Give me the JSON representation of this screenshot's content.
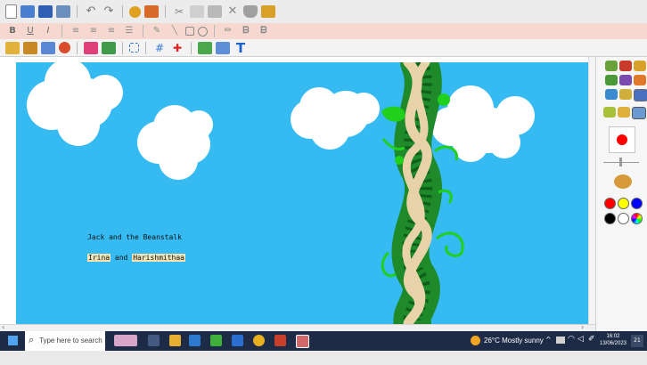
{
  "toolbars": {
    "row1": [
      "new-icon",
      "open-icon",
      "save-icon",
      "print-icon",
      "undo-icon",
      "redo-icon",
      "refresh-icon",
      "paint-icon",
      "cut-icon",
      "copy-icon",
      "paste-icon",
      "delete-icon",
      "shield-icon",
      "image-icon"
    ],
    "row2": [
      "bold-icon",
      "underline-icon",
      "italic-icon",
      "align-left-icon",
      "align-center-icon",
      "align-right-icon",
      "justify-icon",
      "pen-icon",
      "line-icon",
      "rectangle-icon",
      "ellipse-icon",
      "pencil-icon",
      "shape-b-icon",
      "shape-c-icon"
    ],
    "row3": [
      "brush-icon",
      "fill-icon",
      "eraser-icon",
      "stamp-icon",
      "flower-icon",
      "spray-icon",
      "select-icon",
      "grid-icon",
      "color-pick-icon",
      "paint-bucket-icon",
      "resize-icon",
      "text-tool-icon"
    ],
    "text_tool_label": "T",
    "format_labels": {
      "bold": "B",
      "underline": "U",
      "italic": "I"
    }
  },
  "canvas": {
    "title_text": "Jack and the Beanstalk",
    "author_1": "Irina",
    "joiner": "and",
    "author_2": "Harishmithaa",
    "sky_color": "#35baf1"
  },
  "palette": {
    "current_color": "#ff0000",
    "colors": [
      "#ff0000",
      "#ffff00",
      "#0000ff",
      "#000000",
      "#ffffff",
      "rainbow"
    ]
  },
  "taskbar": {
    "search_placeholder": "Type here to search",
    "weather": "26°C  Mostly sunny",
    "time": "16:02",
    "date": "13/06/2023",
    "notification_count": "21"
  }
}
